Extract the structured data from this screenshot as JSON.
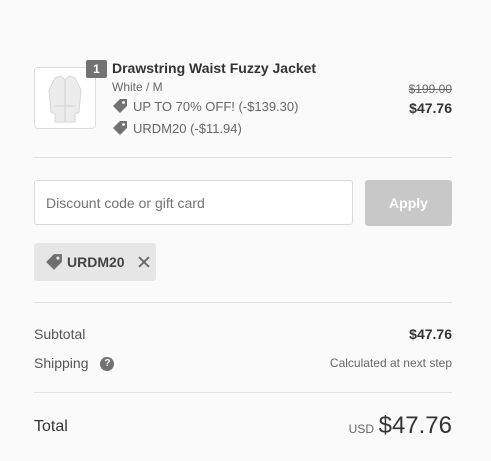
{
  "product": {
    "quantity": "1",
    "title": "Drawstring Waist Fuzzy Jacket",
    "variant": "White / M",
    "discounts": [
      {
        "icon": "tag-icon",
        "text": "UP TO 70% OFF! (-$139.30)"
      },
      {
        "icon": "tag-icon",
        "text": "URDM20 (-$11.94)"
      }
    ],
    "original_price": "$199.00",
    "final_price": "$47.76"
  },
  "discount_form": {
    "placeholder": "Discount code or gift card",
    "value": "",
    "apply_label": "Apply"
  },
  "applied_code": {
    "icon": "tag-icon",
    "code": "URDM20",
    "remove_icon": "close-icon"
  },
  "summary": {
    "subtotal_label": "Subtotal",
    "subtotal_value": "$47.76",
    "shipping_label": "Shipping",
    "shipping_help_icon": "question-icon",
    "shipping_help_glyph": "?",
    "shipping_value": "Calculated at next step",
    "total_label": "Total",
    "total_currency": "USD",
    "total_value": "$47.76"
  },
  "colors": {
    "apply_button_disabled": "#c8c8c8",
    "badge": "#727272",
    "chip_background": "#e6e6e6"
  }
}
